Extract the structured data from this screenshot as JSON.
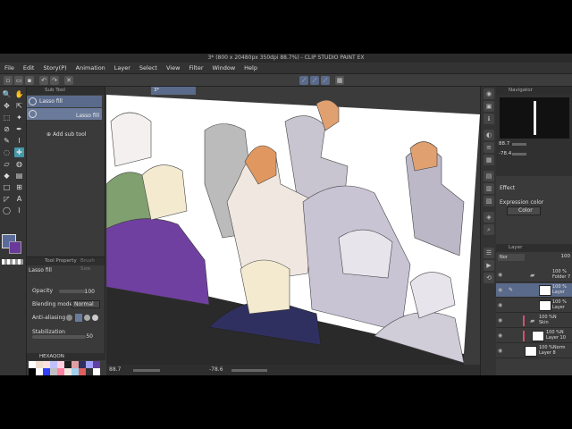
{
  "app": {
    "title": "3* (800 x 20480px 350dpi 88.7%)  - CLIP STUDIO PAINT EX"
  },
  "menu": [
    "File",
    "Edit",
    "Story(P)",
    "Animation",
    "Layer",
    "Select",
    "View",
    "Filter",
    "Window",
    "Help"
  ],
  "subtool": {
    "tab_label": "Sub Tool",
    "item1": "Lasso fill",
    "item2": "Lasso fill",
    "add_label": "Add sub tool"
  },
  "tool_property": {
    "tab_label": "Tool Property",
    "tab2_label": "Brush Size",
    "tool_name": "Lasso fill",
    "opacity_label": "Opacity",
    "opacity_value": "100",
    "blend_label": "Blending mode",
    "blend_value": "Normal",
    "aa_label": "Anti-aliasing",
    "stab_label": "Stabilization",
    "stab_value": "50"
  },
  "palette": {
    "tab_label": "HEXAQON",
    "colors": [
      "#ffffff",
      "#f0e0d0",
      "#ffe0e0",
      "#c0c0ff",
      "#ffd0e0",
      "#202020",
      "#e0a0a0",
      "#303060",
      "#a0a0ff",
      "#6040a0",
      "#000000",
      "#ffffff",
      "#3040ff",
      "#c0c0c0",
      "#ff80a0",
      "#f0e8e0",
      "#a0d0f0",
      "#e06060",
      "#303030",
      "#ffffff"
    ]
  },
  "canvas": {
    "doc_tab": "3*",
    "zoom": "88.7",
    "angle": "-78.6"
  },
  "navigator": {
    "tab_label": "Navigator",
    "zoom": "88.7",
    "angle": "-78.4"
  },
  "effect": {
    "label": "Effect",
    "expression_label": "Expression color",
    "expression_value": "Color"
  },
  "layer": {
    "tab_label": "Layer",
    "blend": "Nor",
    "opacity": "100",
    "rows": [
      {
        "l1": "100 %",
        "l2": "Folder 7"
      },
      {
        "l1": "100 %",
        "l2": "Layer"
      },
      {
        "l1": "100 %",
        "l2": "Layer"
      },
      {
        "l1": "100 %N",
        "l2": "Skin"
      },
      {
        "l1": "100 %N",
        "l2": "Layer 10"
      },
      {
        "l1": "100 %Norm",
        "l2": "Layer 8"
      }
    ]
  }
}
